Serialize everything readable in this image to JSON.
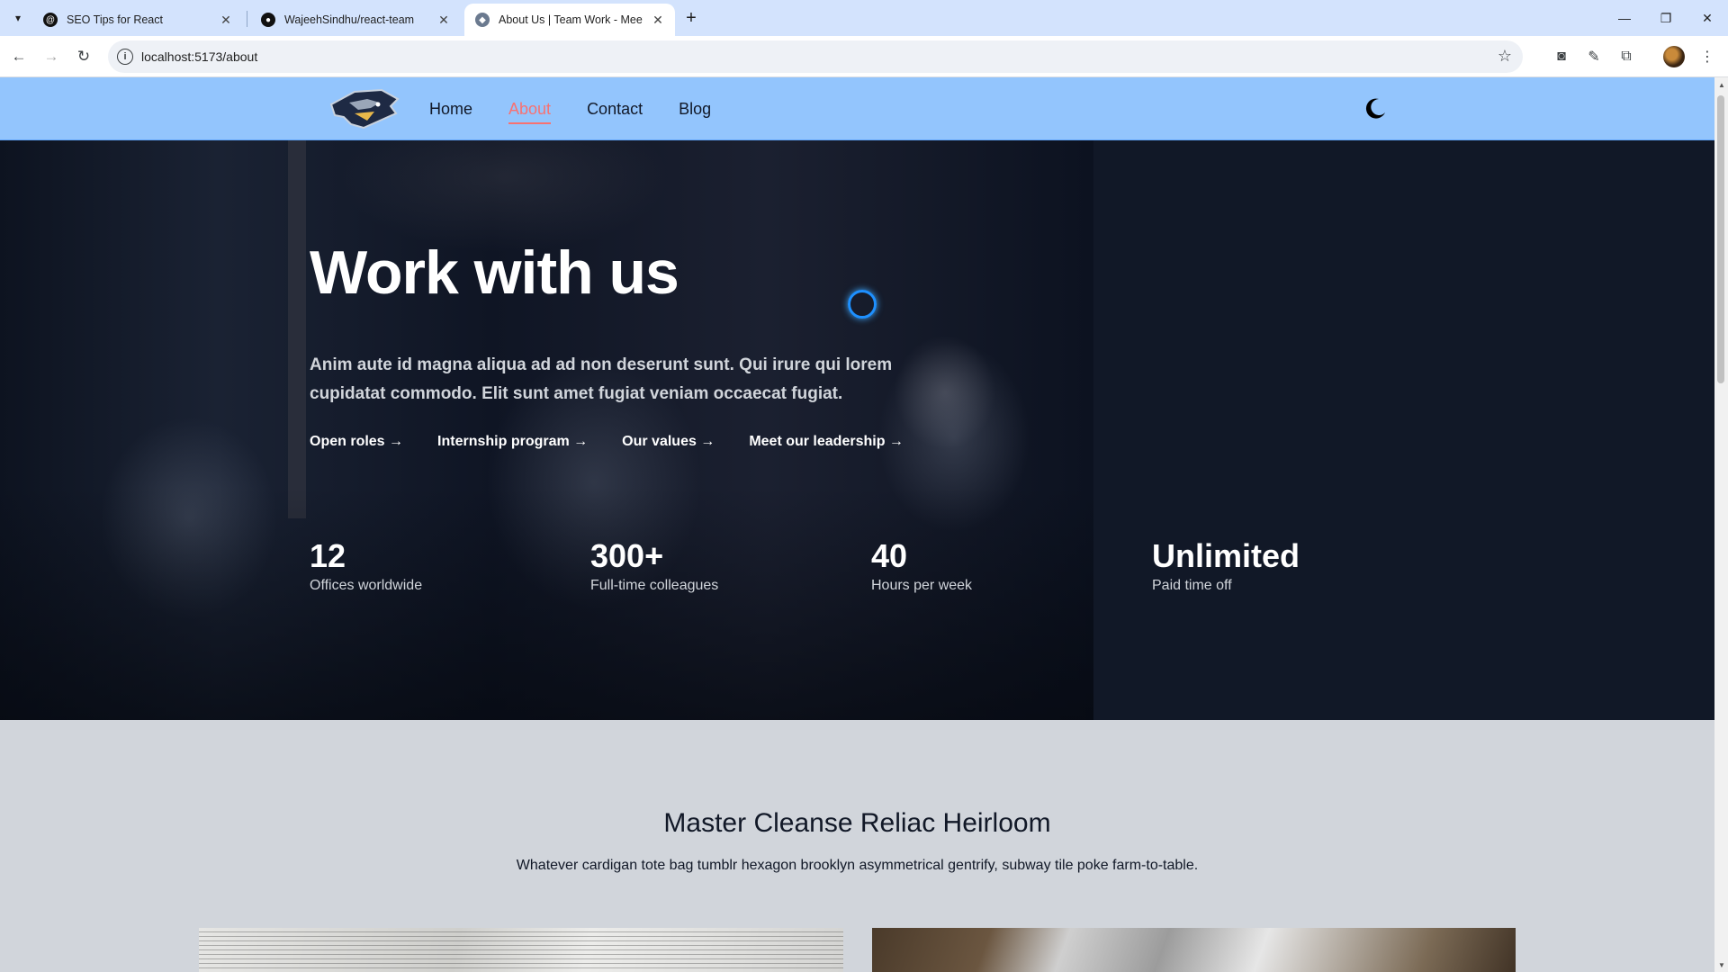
{
  "browser": {
    "tabs": [
      {
        "title": "SEO Tips for React",
        "favicon": "threads-icon"
      },
      {
        "title": "WajeehSindhu/react-team",
        "favicon": "github-icon"
      },
      {
        "title": "About Us | Team Work - Meet t",
        "favicon": "predator-logo-icon",
        "active": true
      }
    ],
    "url": "localhost:5173/about"
  },
  "site": {
    "nav": [
      "Home",
      "About",
      "Contact",
      "Blog"
    ],
    "active_nav": "About"
  },
  "hero": {
    "title": "Work with us",
    "subtitle": "Anim aute id magna aliqua ad ad non deserunt sunt. Qui irure qui lorem cupidatat commodo. Elit sunt amet fugiat veniam occaecat fugiat.",
    "links": [
      "Open roles →",
      "Internship program →",
      "Our values →",
      "Meet our leadership →"
    ],
    "stats": [
      {
        "value": "12",
        "label": "Offices worldwide"
      },
      {
        "value": "300+",
        "label": "Full-time colleagues"
      },
      {
        "value": "40",
        "label": "Hours per week"
      },
      {
        "value": "Unlimited",
        "label": "Paid time off"
      }
    ]
  },
  "section": {
    "title": "Master Cleanse Reliac Heirloom",
    "subtitle": "Whatever cardigan tote bag tumblr hexagon brooklyn asymmetrical gentrify, subway tile poke farm-to-table."
  },
  "colors": {
    "header_bg": "#93c5fd",
    "active_nav": "#f87171",
    "hero_bg": "#111827",
    "page_bg": "#d1d5db"
  }
}
